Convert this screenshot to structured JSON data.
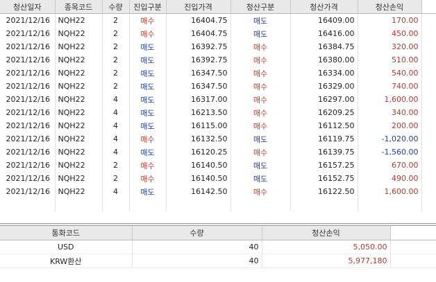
{
  "trades": {
    "headers": [
      "청산일자",
      "종목코드",
      "수량",
      "진입구분",
      "진입가격",
      "청산구분",
      "청산가격",
      "청산손익"
    ],
    "rows": [
      {
        "date": "2021/12/16",
        "code": "NQH22",
        "qty": "2",
        "entry_side": "매수",
        "entry_price": "16404.75",
        "exit_side": "매도",
        "exit_price": "16409.00",
        "pnl": "170.00"
      },
      {
        "date": "2021/12/16",
        "code": "NQH22",
        "qty": "2",
        "entry_side": "매수",
        "entry_price": "16404.75",
        "exit_side": "매도",
        "exit_price": "16416.00",
        "pnl": "450.00"
      },
      {
        "date": "2021/12/16",
        "code": "NQH22",
        "qty": "2",
        "entry_side": "매도",
        "entry_price": "16392.75",
        "exit_side": "매수",
        "exit_price": "16384.75",
        "pnl": "320.00"
      },
      {
        "date": "2021/12/16",
        "code": "NQH22",
        "qty": "2",
        "entry_side": "매도",
        "entry_price": "16392.75",
        "exit_side": "매수",
        "exit_price": "16380.00",
        "pnl": "510.00"
      },
      {
        "date": "2021/12/16",
        "code": "NQH22",
        "qty": "2",
        "entry_side": "매도",
        "entry_price": "16347.50",
        "exit_side": "매수",
        "exit_price": "16334.00",
        "pnl": "540.00"
      },
      {
        "date": "2021/12/16",
        "code": "NQH22",
        "qty": "2",
        "entry_side": "매도",
        "entry_price": "16347.50",
        "exit_side": "매수",
        "exit_price": "16329.00",
        "pnl": "740.00"
      },
      {
        "date": "2021/12/16",
        "code": "NQH22",
        "qty": "4",
        "entry_side": "매도",
        "entry_price": "16317.00",
        "exit_side": "매수",
        "exit_price": "16297.00",
        "pnl": "1,600.00"
      },
      {
        "date": "2021/12/16",
        "code": "NQH22",
        "qty": "4",
        "entry_side": "매도",
        "entry_price": "16213.50",
        "exit_side": "매수",
        "exit_price": "16209.25",
        "pnl": "340.00"
      },
      {
        "date": "2021/12/16",
        "code": "NQH22",
        "qty": "4",
        "entry_side": "매도",
        "entry_price": "16115.00",
        "exit_side": "매수",
        "exit_price": "16112.50",
        "pnl": "200.00"
      },
      {
        "date": "2021/12/16",
        "code": "NQH22",
        "qty": "4",
        "entry_side": "매수",
        "entry_price": "16132.50",
        "exit_side": "매도",
        "exit_price": "16119.75",
        "pnl": "-1,020.00"
      },
      {
        "date": "2021/12/16",
        "code": "NQH22",
        "qty": "4",
        "entry_side": "매도",
        "entry_price": "16120.25",
        "exit_side": "매수",
        "exit_price": "16139.75",
        "pnl": "-1,560.00"
      },
      {
        "date": "2021/12/16",
        "code": "NQH22",
        "qty": "2",
        "entry_side": "매수",
        "entry_price": "16140.50",
        "exit_side": "매도",
        "exit_price": "16157.25",
        "pnl": "670.00"
      },
      {
        "date": "2021/12/16",
        "code": "NQH22",
        "qty": "2",
        "entry_side": "매수",
        "entry_price": "16140.50",
        "exit_side": "매도",
        "exit_price": "16152.75",
        "pnl": "490.00"
      },
      {
        "date": "2021/12/16",
        "code": "NQH22",
        "qty": "4",
        "entry_side": "매도",
        "entry_price": "16142.50",
        "exit_side": "매수",
        "exit_price": "16122.50",
        "pnl": "1,600.00"
      }
    ]
  },
  "summary": {
    "headers": [
      "통화코드",
      "수량",
      "청산손익"
    ],
    "rows": [
      {
        "currency": "USD",
        "qty": "40",
        "pnl": "5,050.00"
      },
      {
        "currency": "KRW환산",
        "qty": "40",
        "pnl": "5,977,180"
      }
    ]
  },
  "colors": {
    "buy": "#c0392b",
    "sell": "#1f3f9a",
    "profit": "#b03a2e",
    "loss": "#1f3f9a"
  }
}
